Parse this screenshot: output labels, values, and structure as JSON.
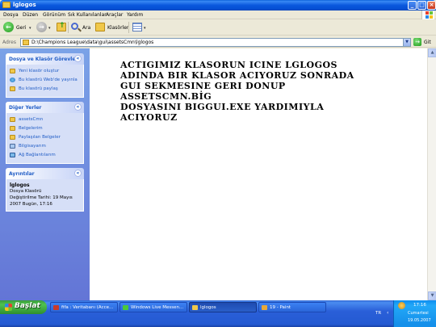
{
  "window": {
    "title": "lglogos",
    "buttons": {
      "minimize": "_",
      "maximize": "□",
      "close": "×"
    }
  },
  "menu": [
    "Dosya",
    "Düzen",
    "Görünüm",
    "Sık Kullanılanlar",
    "Araçlar",
    "Yardım"
  ],
  "toolbar": {
    "back_label": "Geri",
    "search_label": "Ara",
    "folders_label": "Klasörler"
  },
  "address": {
    "label": "Adres",
    "value": "D:\\Champions League\\data\\gui\\assetsCmn\\lglogos",
    "go_label": "Git"
  },
  "taskpane": {
    "file_tasks": {
      "title": "Dosya ve Klasör Görevleri",
      "items": [
        "Yeni klasör oluştur",
        "Bu klasörü Web'de yayınla",
        "Bu klasörü paylaş"
      ]
    },
    "other_places": {
      "title": "Diğer Yerler",
      "items": [
        "assetsCmn",
        "Belgelerim",
        "Paylaşılan Belgeler",
        "Bilgisayarım",
        "Ağ Bağlantılarım"
      ]
    },
    "details": {
      "title": "Ayrıntılar",
      "name": "lglogos",
      "type": "Dosya Klasörü",
      "modified_line1": "Değiştirilme Tarihi: 19 Mayıs",
      "modified_line2": "2007 Bugün, 17:16"
    }
  },
  "content": {
    "text_lines": [
      "ACTIGIMIZ KLASORUN ICINE LGLOGOS",
      "ADINDA BIR KLASOR ACIYORUZ SONRADA",
      "GUI SEKMESINE GERI DONUP ASSETSCMN.BİG",
      "DOSYASINI BIGGUI.EXE YARDIMIYLA",
      "ACIYORUZ"
    ]
  },
  "taskbar": {
    "start_label": "Başlat",
    "buttons": [
      {
        "label": "fifa : Veritabanı (Acce..."
      },
      {
        "label": "Windows Live Messen..."
      },
      {
        "label": "lglogos"
      },
      {
        "label": "19 - Paint"
      }
    ],
    "language": "TR",
    "clock": {
      "time": "17:16",
      "day": "Cumartesi",
      "date": "19.05.2007"
    }
  },
  "colors": {
    "title_bar": "#0a58dd",
    "task_pane": "#6375d6",
    "link": "#215dc6",
    "taskbar": "#245ad2",
    "start_button": "#3b9b3b"
  }
}
